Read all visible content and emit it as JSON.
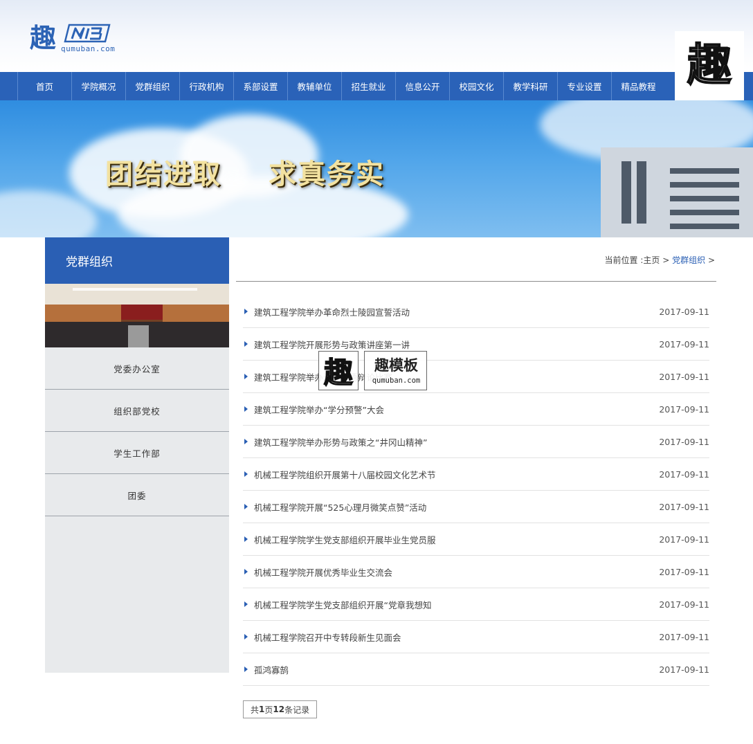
{
  "logo": {
    "glyph": "趣",
    "mark": "MB",
    "site": "qumuban.com"
  },
  "corner_badge": {
    "glyph": "趣"
  },
  "nav": {
    "items": [
      "首页",
      "学院概况",
      "党群组织",
      "行政机构",
      "系部设置",
      "教辅单位",
      "招生就业",
      "信息公开",
      "校园文化",
      "教学科研",
      "专业设置",
      "精品教程"
    ]
  },
  "banner": {
    "slogan_left": "团结进取",
    "slogan_right": "求真务实"
  },
  "sidebar": {
    "title": "党群组织",
    "items": [
      "党委办公室",
      "组织部党校",
      "学生工作部",
      "团委"
    ]
  },
  "breadcrumb": {
    "prefix": "当前位置 :",
    "home": "主页",
    "sep": ">",
    "current": "党群组织",
    "tail": ">"
  },
  "news": [
    {
      "title": "建筑工程学院举办革命烈士陵园宣誓活动",
      "date": "2017-09-11"
    },
    {
      "title": "建筑工程学院开展形势与政策讲座第一讲",
      "date": "2017-09-11"
    },
    {
      "title": "建筑工程学院举办湖畔英语辩论比赛",
      "date": "2017-09-11"
    },
    {
      "title": "建筑工程学院举办“学分预警”大会",
      "date": "2017-09-11"
    },
    {
      "title": "建筑工程学院举办形势与政策之“井冈山精神”",
      "date": "2017-09-11"
    },
    {
      "title": "机械工程学院组织开展第十八届校园文化艺术节",
      "date": "2017-09-11"
    },
    {
      "title": "机械工程学院开展“525心理月微笑点赞”活动",
      "date": "2017-09-11"
    },
    {
      "title": "机械工程学院学生党支部组织开展毕业生党员服",
      "date": "2017-09-11"
    },
    {
      "title": "机械工程学院开展优秀毕业生交流会",
      "date": "2017-09-11"
    },
    {
      "title": "机械工程学院学生党支部组织开展“党章我想知",
      "date": "2017-09-11"
    },
    {
      "title": "机械工程学院召开中专转段新生见面会",
      "date": "2017-09-11"
    },
    {
      "title": "孤鸿寡鹄",
      "date": "2017-09-11"
    }
  ],
  "pager": {
    "prefix": "共 ",
    "pages": "1",
    "mid": "页",
    "records": "12",
    "suffix": "条记录"
  },
  "watermark": {
    "glyph": "趣",
    "title": "趣模板",
    "site": "qumuban.com"
  },
  "colors": {
    "primary": "#2a62b8",
    "sidebar_bg": "#e8eaec"
  }
}
